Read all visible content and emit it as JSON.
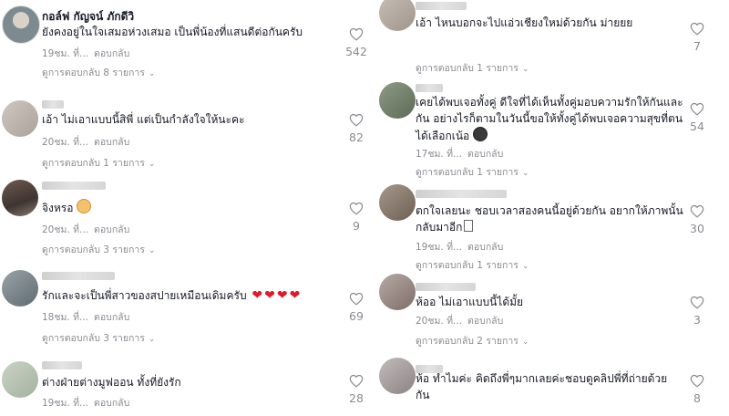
{
  "left": [
    {
      "name": "กอล์ฟ กัญจน์ ภักดีวิ",
      "text": "ยังคงอยู่ในใจเสมอห่วงเสมอ เป็นพี่น้องที่แสนดีต่อกันครับ",
      "time": "19ชม. ที่...",
      "reply": "ตอบกลับ",
      "replies": "ดูการตอบกลับ 8 รายการ",
      "likes": "542"
    },
    {
      "name": "",
      "text": "เอ้า ไม่เอาแบบนี้สิพี่ แต่เป็นกำลังใจให้นะคะ",
      "time": "20ชม. ที่...",
      "reply": "ตอบกลับ",
      "replies": "ดูการตอบกลับ 1 รายการ",
      "likes": "82"
    },
    {
      "name": "",
      "text": "จิงหรอ",
      "time": "20ชม. ที่...",
      "reply": "ตอบกลับ",
      "replies": "ดูการตอบกลับ 3 รายการ",
      "likes": "9"
    },
    {
      "name": "",
      "text": "รักและจะเป็นพี่สาวของสปายเหมือนเดิมครับ",
      "time": "18ชม. ที่...",
      "reply": "ตอบกลับ",
      "replies": "ดูการตอบกลับ 3 รายการ",
      "likes": "69"
    },
    {
      "name": "",
      "text": "ต่างฝ่ายต่างมูฟออน ทั้งที่ยังรัก",
      "time": "19ชม. ที่...",
      "reply": "ตอบกลับ",
      "replies": "",
      "likes": "28"
    }
  ],
  "right": [
    {
      "name": "",
      "text": "เอ้า ไหนบอกจะไปแอ่วเชียงใหม่ด้วยกัน ม่ายยย",
      "time": "",
      "reply": "",
      "replies": "ดูการตอบกลับ 1 รายการ",
      "likes": "7"
    },
    {
      "name": "",
      "text1": "เคยได้พบเจอทั้งคู่ ดีใจที่ได้เห็นทั้งคู่มอบความรักให้กันและ",
      "text2": "กัน อย่างไรก็ตามในวันนี้ขอให้ทั้งคู่ได้พบเจอความสุขที่ตน",
      "text3": "ได้เลือกเน้อ",
      "time": "17ชม. ที่...",
      "reply": "ตอบกลับ",
      "replies": "ดูการตอบกลับ 1 รายการ",
      "likes": "54"
    },
    {
      "name": "",
      "text1": "ตกใจเลยนะ ชอบเวลาสองคนนี้อยู่ด้วยกัน อยากให้ภาพนั้น",
      "text2": "กลับมาอีก",
      "time": "19ชม. ที่...",
      "reply": "ตอบกลับ",
      "replies": "ดูการตอบกลับ 1 รายการ",
      "likes": "30"
    },
    {
      "name": "",
      "text": "ห้ออ ไม่เอาแบบนี้ได้มั้ย",
      "time": "20ชม. ที่...",
      "reply": "ตอบกลับ",
      "replies": "ดูการตอบกลับ 2 รายการ",
      "likes": "3"
    },
    {
      "name": "",
      "text1": "ห้อ ทำไมค่ะ คิดถึงพี่ๆมากเลยค่ะชอบดูคลิปพี่ที่ถ่ายด้วย",
      "text2": "กัน",
      "time": "",
      "reply": "",
      "replies": "",
      "likes": "8"
    }
  ],
  "icons": {
    "heart": "heart-outline-icon",
    "chevron": "chevron-down-icon"
  },
  "colors": {
    "muted": "#8a8b91",
    "text": "#161823",
    "emoji_heart": "#e0182d"
  }
}
